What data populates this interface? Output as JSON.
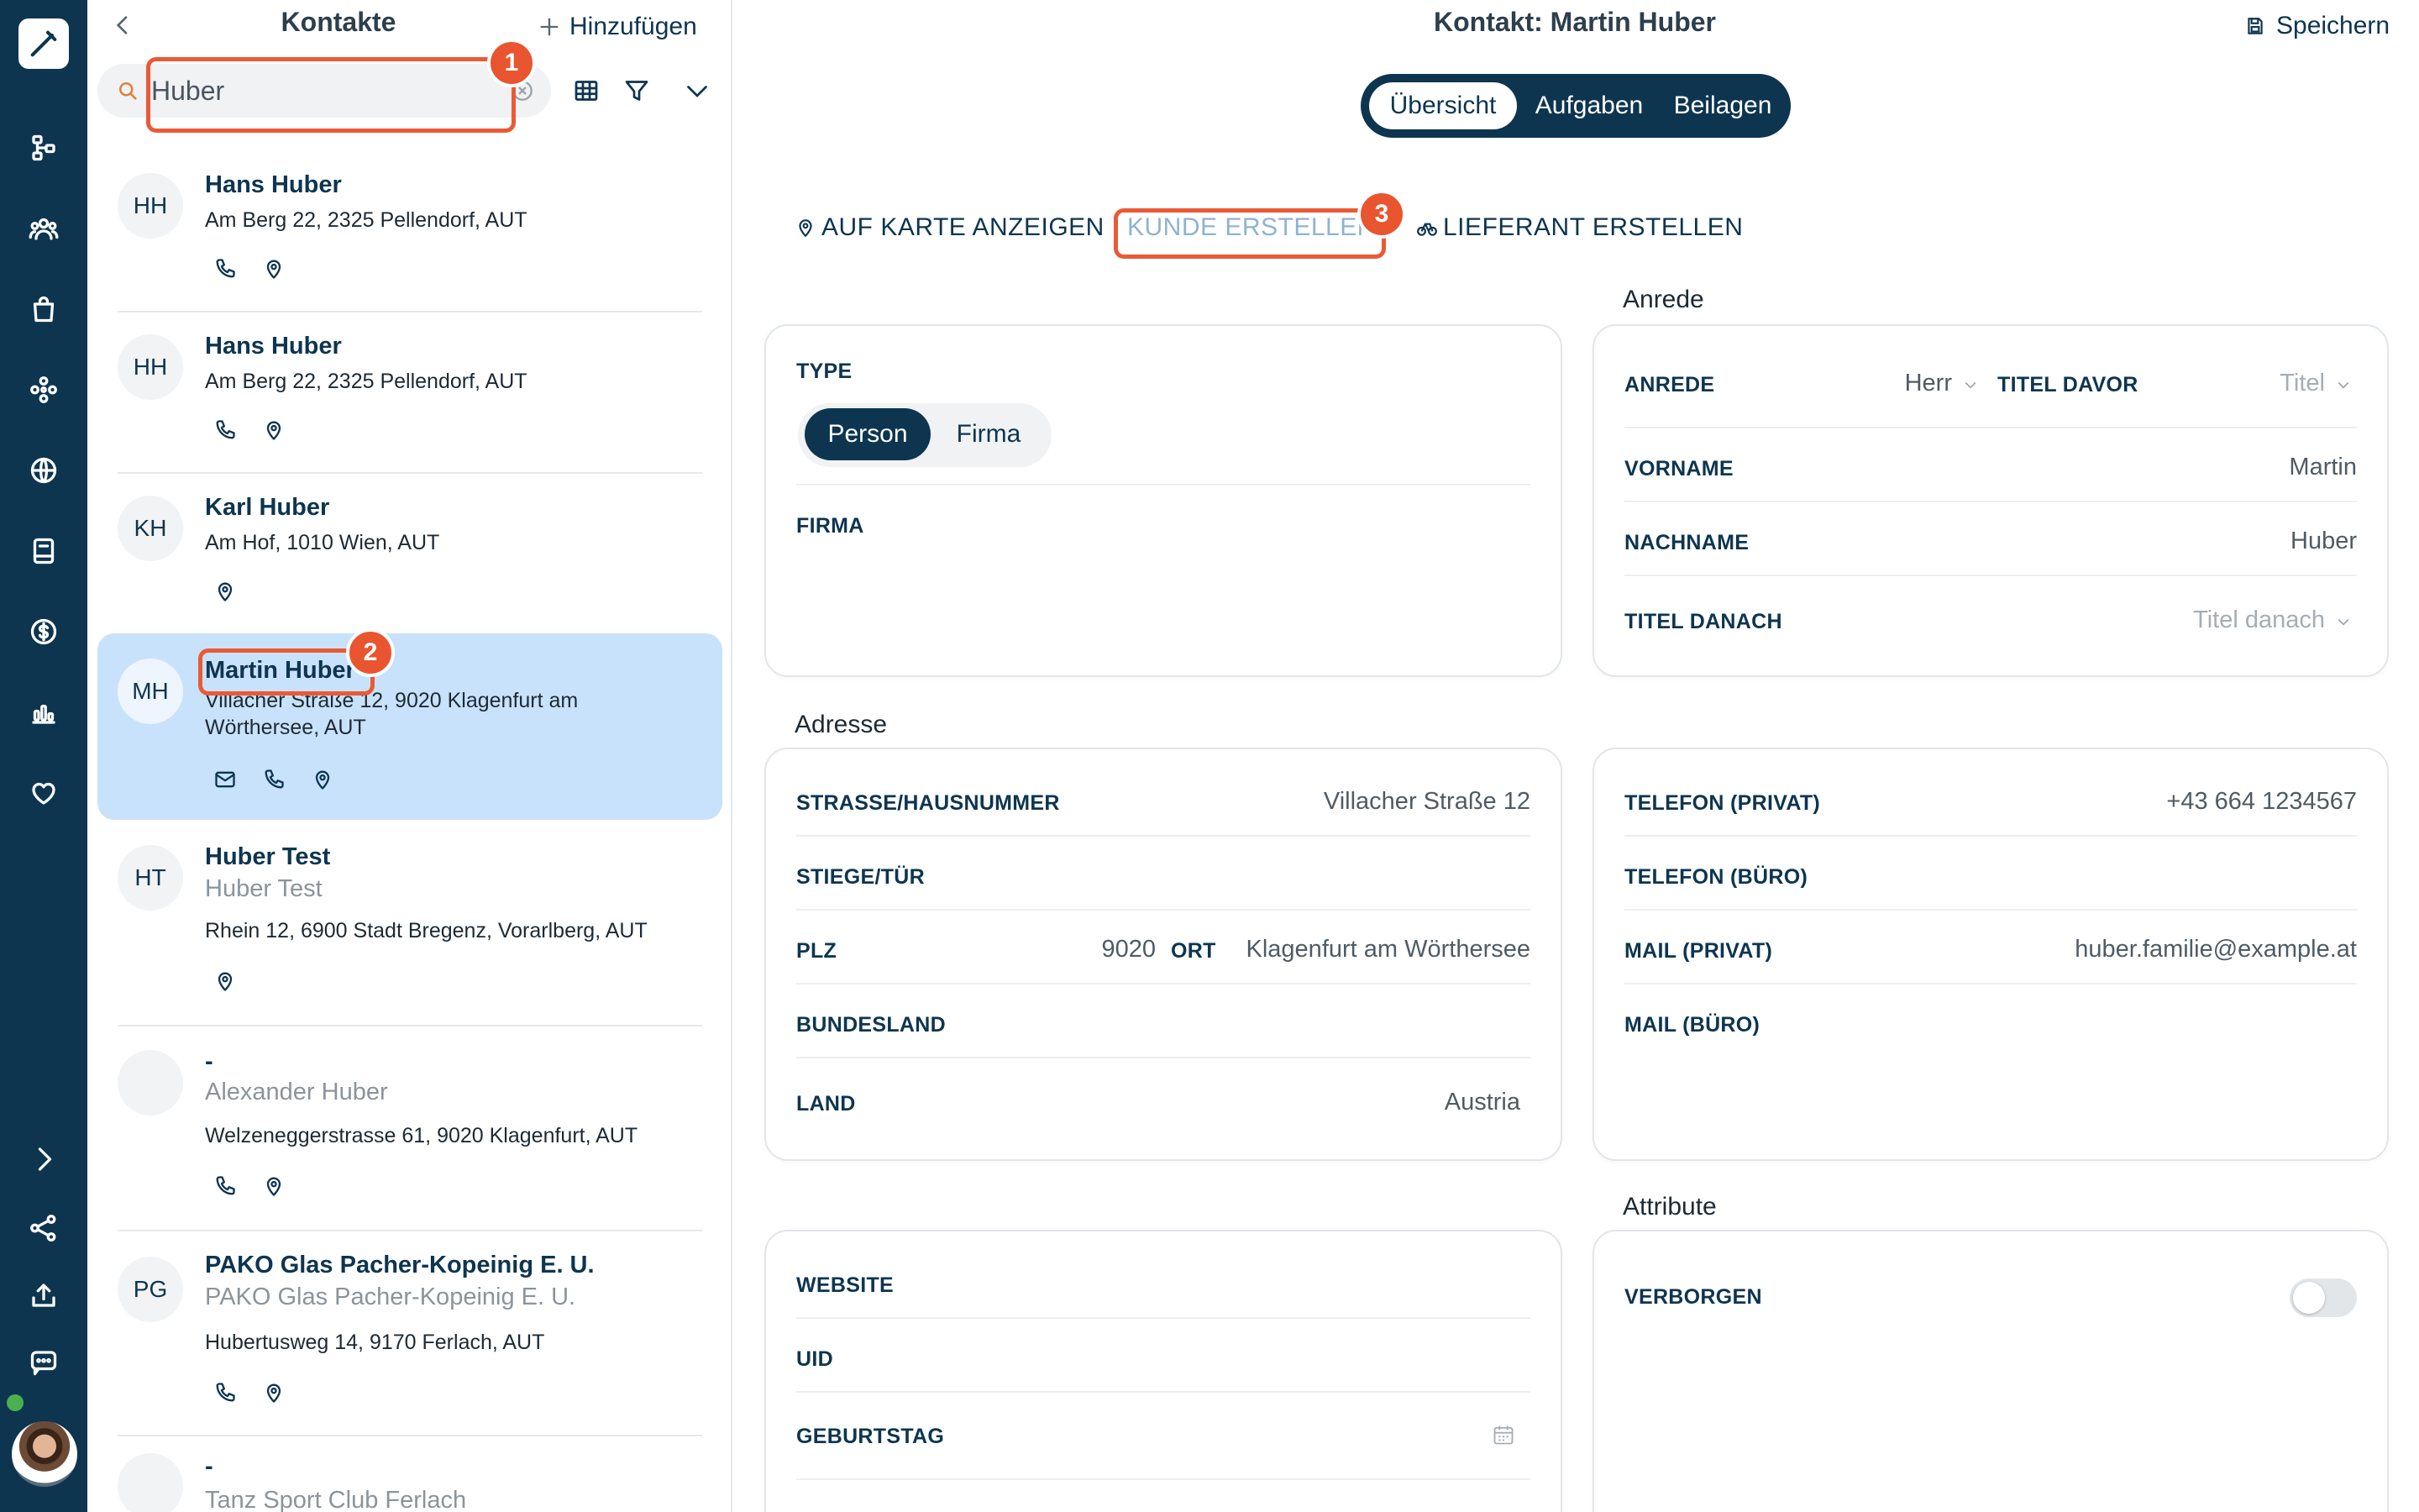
{
  "sidebar": {
    "icons": [
      "pen-icon",
      "hierarchy-icon",
      "people-icon",
      "bag-icon",
      "modules-icon",
      "globe-icon",
      "book-icon",
      "dollar-icon",
      "chart-icon",
      "heart-icon",
      "expand-icon",
      "share-icon",
      "upload-icon",
      "chat-icon"
    ]
  },
  "contacts": {
    "title": "Kontakte",
    "add_label": "Hinzufügen",
    "search_value": "Huber",
    "items": [
      {
        "initials": "HH",
        "name": "Hans Huber",
        "subtitle": "",
        "address": "Am Berg 22, 2325 Pellendorf, AUT"
      },
      {
        "initials": "HH",
        "name": "Hans Huber",
        "subtitle": "",
        "address": "Am Berg 22, 2325 Pellendorf, AUT"
      },
      {
        "initials": "KH",
        "name": "Karl Huber",
        "subtitle": "",
        "address": "Am Hof, 1010 Wien, AUT"
      },
      {
        "initials": "MH",
        "name": "Martin Huber",
        "subtitle": "",
        "address": "Villacher Straße 12, 9020 Klagenfurt am Wörthersee, AUT"
      },
      {
        "initials": "HT",
        "name": "Huber Test",
        "subtitle": "Huber Test",
        "address": "Rhein 12, 6900 Stadt Bregenz, Vorarlberg, AUT"
      },
      {
        "initials": "",
        "name": "-",
        "subtitle": "Alexander Huber",
        "address": "Welzeneggerstrasse 61, 9020 Klagenfurt, AUT"
      },
      {
        "initials": "PG",
        "name": "PAKO Glas Pacher-Kopeinig E. U.",
        "subtitle": "PAKO Glas Pacher-Kopeinig E. U.",
        "address": "Hubertusweg 14, 9170 Ferlach, AUT"
      },
      {
        "initials": "",
        "name": "-",
        "subtitle": "Tanz Sport Club Ferlach",
        "address": ""
      }
    ]
  },
  "badges": [
    "1",
    "2",
    "3"
  ],
  "detail": {
    "title": "Kontakt: Martin Huber",
    "save_label": "Speichern",
    "tabs": [
      "Übersicht",
      "Aufgaben",
      "Beilagen"
    ],
    "actions": {
      "map": "AUF KARTE ANZEIGEN",
      "customer": "KUNDE ERSTELLEN",
      "supplier": "LIEFERANT ERSTELLEN"
    },
    "type_box": {
      "type_label": "TYPE",
      "options": [
        "Person",
        "Firma"
      ],
      "firma_label": "FIRMA"
    },
    "salutation": {
      "section": "Anrede",
      "anrede_label": "ANREDE",
      "anrede_value": "Herr",
      "titel_davor_label": "TITEL DAVOR",
      "titel_davor_placeholder": "Titel",
      "vorname_label": "VORNAME",
      "vorname_value": "Martin",
      "nachname_label": "NACHNAME",
      "nachname_value": "Huber",
      "titel_danach_label": "TITEL DANACH",
      "titel_danach_placeholder": "Titel danach"
    },
    "address": {
      "section": "Adresse",
      "strasse_label": "STRASSE/HAUSNUMMER",
      "strasse_value": "Villacher Straße 12",
      "stiege_label": "STIEGE/TÜR",
      "plz_label": "PLZ",
      "plz_value": "9020",
      "ort_label": "ORT",
      "ort_value": "Klagenfurt am Wörthersee",
      "bundesland_label": "BUNDESLAND",
      "land_label": "LAND",
      "land_value": "Austria"
    },
    "contact": {
      "tel_privat_label": "TELEFON (PRIVAT)",
      "tel_privat_value": "+43 664 1234567",
      "tel_buero_label": "TELEFON (BÜRO)",
      "mail_privat_label": "MAIL (PRIVAT)",
      "mail_privat_value": "huber.familie@example.at",
      "mail_buero_label": "MAIL (BÜRO)"
    },
    "misc": {
      "website_label": "WEBSITE",
      "uid_label": "UID",
      "geburtstag_label": "GEBURTSTAG"
    },
    "attribute": {
      "section": "Attribute",
      "verborgen_label": "VERBORGEN"
    }
  },
  "colors": {
    "primary": "#0d3550",
    "highlight": "#ea5a35",
    "selected_bg": "#c9e2fb"
  }
}
